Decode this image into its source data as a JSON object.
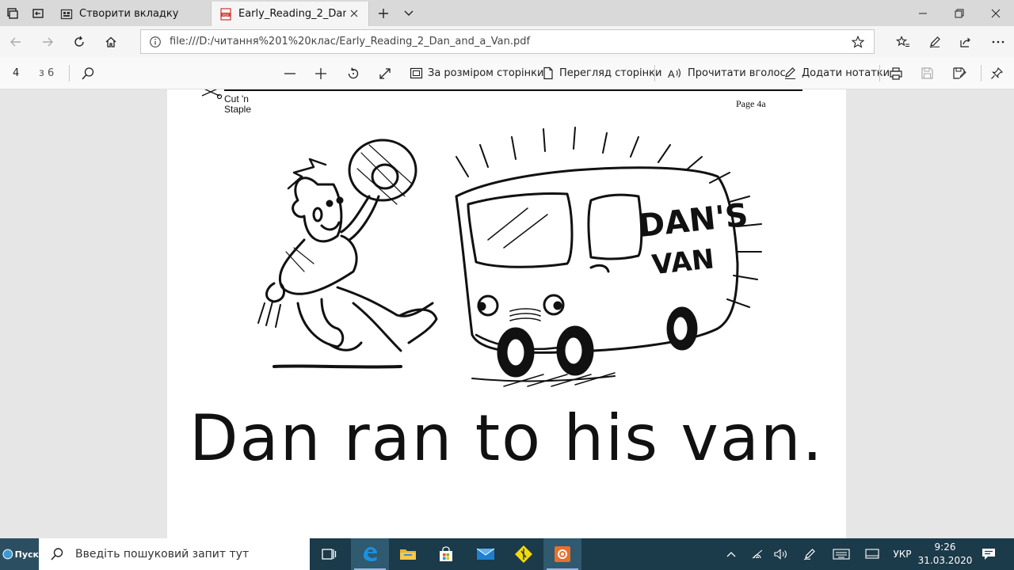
{
  "tabs": [
    {
      "label": "Створити вкладку",
      "active": false
    },
    {
      "label": "Early_Reading_2_Dan_and_a_Van.pdf",
      "active": true
    }
  ],
  "address": {
    "url": "file:///D:/читання%201%20клас/Early_Reading_2_Dan_and_a_Van.pdf"
  },
  "pdf_toolbar": {
    "page_current": "4",
    "page_total": "з 6",
    "fit_page": "За розміром сторінки",
    "page_view": "Перегляд сторінки",
    "read_aloud": "Прочитати вголос",
    "add_notes": "Додати нотатки"
  },
  "document": {
    "cut_label_1": "Cut 'n",
    "cut_label_2": "Staple",
    "page_number": "Page 4a",
    "van_text_1": "DAN'S",
    "van_text_2": "VAN",
    "caption": "Dan ran to his van."
  },
  "taskbar": {
    "start_label": "Пуск",
    "search_placeholder": "Введіть пошуковий запит тут",
    "language": "УКР",
    "time": "9:26",
    "date": "31.03.2020"
  },
  "colors": {
    "tabstrip": "#d9d9d9",
    "toolbar": "#f5f5f5",
    "viewport": "#e6e6e6",
    "taskbar": "#1b3a4a",
    "edge_blue": "#0a79d6"
  }
}
